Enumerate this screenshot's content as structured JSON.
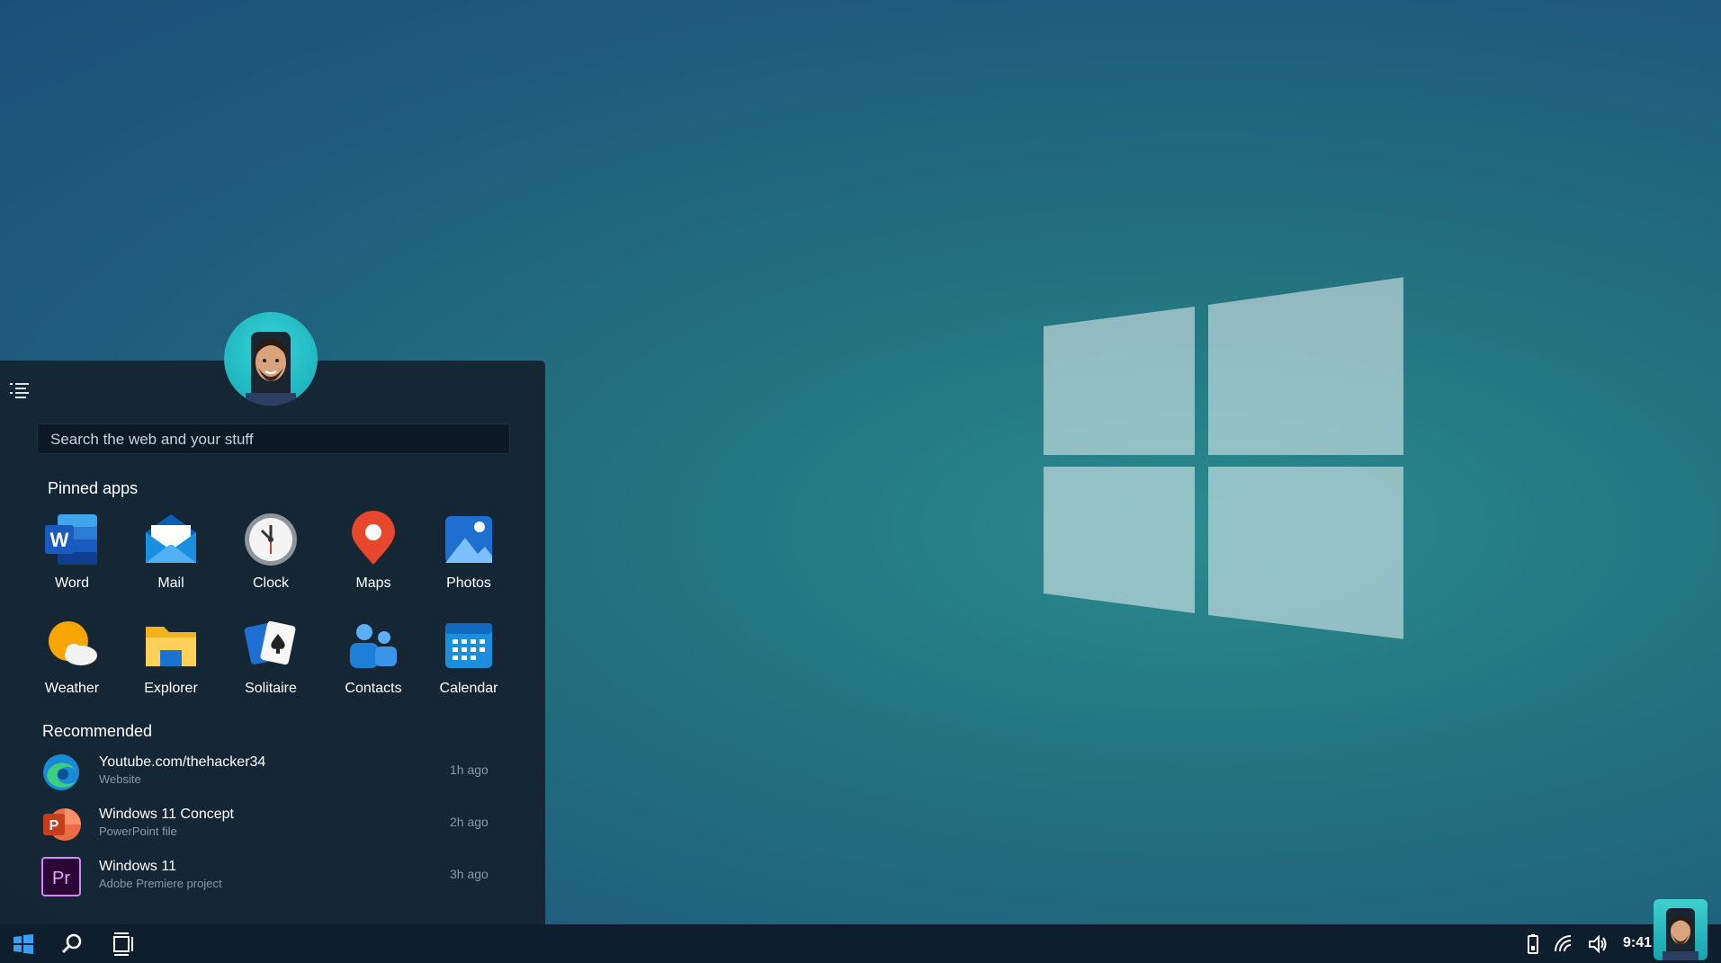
{
  "start_menu": {
    "search_placeholder": "Search the web and your stuff",
    "pinned_title": "Pinned apps",
    "recommended_title": "Recommended",
    "pinned_apps": [
      {
        "label": "Word",
        "icon": "word-icon"
      },
      {
        "label": "Mail",
        "icon": "mail-icon"
      },
      {
        "label": "Clock",
        "icon": "clock-icon"
      },
      {
        "label": "Maps",
        "icon": "maps-icon"
      },
      {
        "label": "Photos",
        "icon": "photos-icon"
      },
      {
        "label": "Weather",
        "icon": "weather-icon"
      },
      {
        "label": "Explorer",
        "icon": "folder-icon"
      },
      {
        "label": "Solitaire",
        "icon": "cards-icon"
      },
      {
        "label": "Contacts",
        "icon": "contacts-icon"
      },
      {
        "label": "Calendar",
        "icon": "calendar-icon"
      }
    ],
    "recommended": [
      {
        "name": "Youtube.com/thehacker34",
        "type": "Website",
        "time": "1h ago",
        "icon": "edge-icon"
      },
      {
        "name": "Windows 11 Concept",
        "type": "PowerPoint file",
        "time": "2h ago",
        "icon": "powerpoint-icon"
      },
      {
        "name": "Windows 11",
        "type": "Adobe Premiere project",
        "time": "3h ago",
        "icon": "premiere-icon"
      }
    ]
  },
  "taskbar": {
    "clock": "9:41 AM"
  },
  "colors": {
    "accent": "#1a8fe0",
    "menu_bg": "#152432",
    "taskbar_bg": "#0f1e2c"
  }
}
